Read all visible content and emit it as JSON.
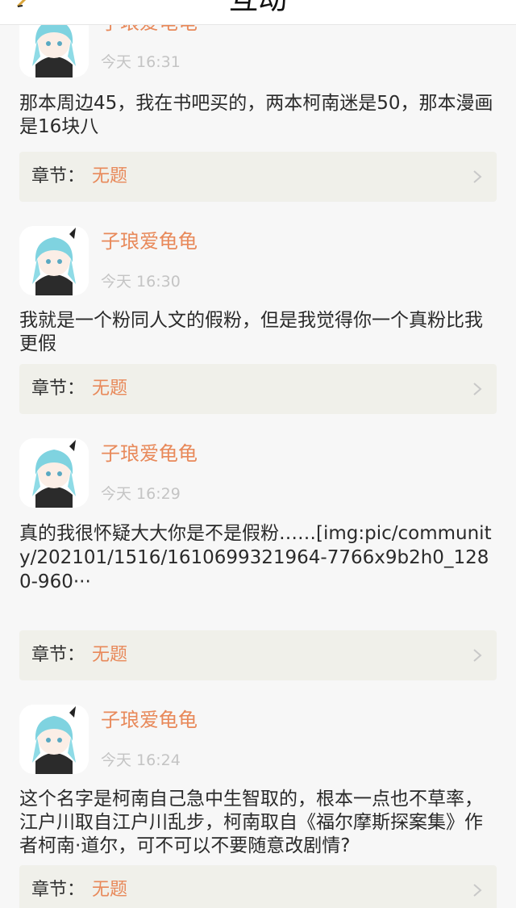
{
  "header": {
    "title": "互动"
  },
  "comments": [
    {
      "username": "子琅爱龟龟",
      "time": "今天 16:31",
      "text": "那本周边45，我在书吧买的，两本柯南迷是50，那本漫画是16块八",
      "chapter_label": "章节：",
      "chapter_value": "无题"
    },
    {
      "username": "子琅爱龟龟",
      "time": "今天 16:30",
      "text": "我就是一个粉同人文的假粉，但是我觉得你一个真粉比我更假",
      "chapter_label": "章节：",
      "chapter_value": "无题"
    },
    {
      "username": "子琅爱龟龟",
      "time": "今天 16:29",
      "text": "真的我很怀疑大大你是不是假粉……[img:pic/community/202101/1516/1610699321964-7766x9b2h0_1280-960···",
      "chapter_label": "章节：",
      "chapter_value": "无题"
    },
    {
      "username": "子琅爱龟龟",
      "time": "今天 16:24",
      "text": "这个名字是柯南自己急中生智取的，根本一点也不草率，江户川取自江户川乱步，柯南取自《福尔摩斯探案集》作者柯南·道尔，可不可以不要随意改剧情?",
      "chapter_label": "章节：",
      "chapter_value": "无题"
    }
  ],
  "colors": {
    "accent": "#e8895a",
    "timestamp": "#c4c4c4",
    "chapter_bg": "#f0f0ea"
  }
}
